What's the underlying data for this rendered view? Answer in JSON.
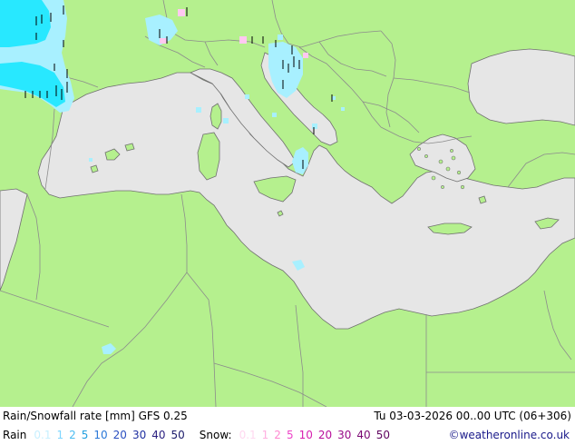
{
  "footer": {
    "title": "Rain/Snowfall rate [mm] GFS 0.25",
    "datetime": "Tu 03-03-2026 00..00 UTC (06+306)",
    "rain_label": "Rain",
    "snow_label": "Snow:",
    "credit": "©weatheronline.co.uk"
  },
  "legend": {
    "rain": [
      {
        "label": "0.1",
        "color": "#c8f0ff"
      },
      {
        "label": "1",
        "color": "#7fd6ff"
      },
      {
        "label": "2",
        "color": "#4cbcf0"
      },
      {
        "label": "5",
        "color": "#1f9fe0"
      },
      {
        "label": "10",
        "color": "#2a78d8"
      },
      {
        "label": "20",
        "color": "#2a4fc0"
      },
      {
        "label": "30",
        "color": "#1f2fa0"
      },
      {
        "label": "40",
        "color": "#2a1f80"
      },
      {
        "label": "50",
        "color": "#1a1a6a"
      }
    ],
    "snow": [
      {
        "label": "0.1",
        "color": "#ffd8f0"
      },
      {
        "label": "1",
        "color": "#ffb0e0"
      },
      {
        "label": "2",
        "color": "#ff88d0"
      },
      {
        "label": "5",
        "color": "#ee44c8"
      },
      {
        "label": "10",
        "color": "#d820b0"
      },
      {
        "label": "20",
        "color": "#b8109c"
      },
      {
        "label": "30",
        "color": "#980c88"
      },
      {
        "label": "40",
        "color": "#7a0872"
      },
      {
        "label": "50",
        "color": "#600460"
      }
    ]
  },
  "colors": {
    "land": "#b5f08e",
    "sea": "#e6e6e6",
    "border": "#8c8c8c",
    "coast": "#707070",
    "rain_light": "#a8f0ff",
    "rain_med": "#28e8ff",
    "snow_light": "#ffc8f0"
  }
}
